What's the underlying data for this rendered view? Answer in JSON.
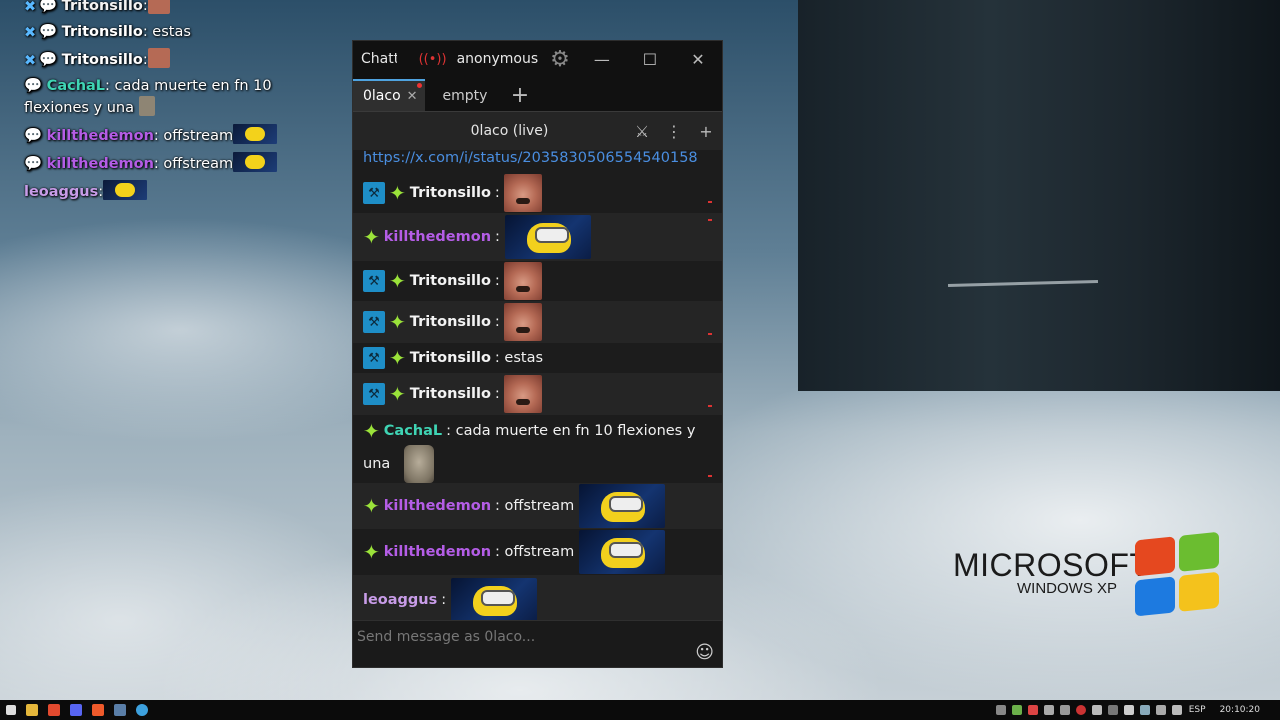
{
  "overlay": {
    "lines": [
      {
        "name": "Tritonsillo",
        "text": ""
      },
      {
        "name": "Tritonsillo",
        "text": " estas"
      },
      {
        "name": "Tritonsillo",
        "text": ""
      },
      {
        "name": "CachaL",
        "text": " cada muerte en fn 10 flexiones y una"
      },
      {
        "name": "killthedemon",
        "text": " offstream"
      },
      {
        "name": "killthedemon",
        "text": " offstream"
      },
      {
        "name": "leoaggus",
        "text": ""
      }
    ]
  },
  "window": {
    "app_name": "Chatterino",
    "user": "anonymous",
    "controls": {
      "minimize": "—",
      "maximize": "☐",
      "close": "✕"
    },
    "tabs": [
      {
        "label": "0laco",
        "close": "✕"
      },
      {
        "label": "empty"
      }
    ],
    "add_tab": "+",
    "split_title": "0laco (live)",
    "link": "https://x.com/i/status/2035830506554540158",
    "messages": [
      {
        "mod": true,
        "name": "Tritonsillo",
        "sep": ":",
        "text": "",
        "emote": "man"
      },
      {
        "mod": false,
        "name": "killthedemon",
        "sep": ":",
        "text": "",
        "emote": "minion"
      },
      {
        "mod": true,
        "name": "Tritonsillo",
        "sep": ":",
        "text": "",
        "emote": "man"
      },
      {
        "mod": true,
        "name": "Tritonsillo",
        "sep": ":",
        "text": "",
        "emote": "man"
      },
      {
        "mod": true,
        "name": "Tritonsillo",
        "sep": ":",
        "text": "estas",
        "emote": ""
      },
      {
        "mod": true,
        "name": "Tritonsillo",
        "sep": ":",
        "text": "",
        "emote": "man"
      },
      {
        "mod": false,
        "name": "CachaL",
        "sep": ":",
        "text": "cada muerte en fn 10 flexiones y",
        "text2": "una",
        "emote": "rock"
      },
      {
        "mod": false,
        "name": "killthedemon",
        "sep": ":",
        "text": "offstream",
        "emote": "minion"
      },
      {
        "mod": false,
        "name": "killthedemon",
        "sep": ":",
        "text": "offstream",
        "emote": "minion"
      },
      {
        "mod": false,
        "name": "leoaggus",
        "sep": ":",
        "text": "",
        "emote": "minion",
        "nostar": true
      }
    ],
    "input_placeholder": "Send message as 0laco..."
  },
  "colors": {
    "Tritonsillo": "#f3f3f3",
    "killthedemon": "#b45de6",
    "CachaL": "#3fd4b4",
    "leoaggus": "#c89ce8",
    "link": "#4a8ee0",
    "accent_tab": "#4fa3e0"
  },
  "logo": {
    "line1": "MICROSOFT",
    "line2": "WINDOWS XP"
  },
  "taskbar": {
    "lang": "ESP",
    "clock": "20:10:20"
  }
}
